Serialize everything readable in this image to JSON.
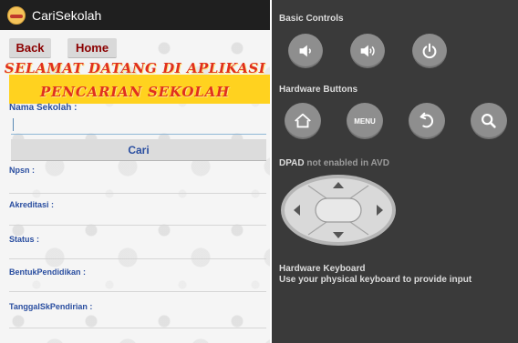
{
  "app": {
    "title": "CariSekolah",
    "buttons": {
      "back": "Back",
      "home": "Home"
    },
    "welcome": {
      "line1": "SELAMAT DATANG DI APLIKASI",
      "line2": "PENCARIAN SEKOLAH"
    },
    "search": {
      "label": "Nama Sekolah :",
      "value": "",
      "button": "Cari"
    },
    "fields": [
      {
        "label": "Npsn :"
      },
      {
        "label": "Akreditasi :"
      },
      {
        "label": "Status :"
      },
      {
        "label": "BentukPendidikan :"
      },
      {
        "label": "TanggalSkPendirian :"
      }
    ],
    "colors": {
      "actionbar": "#1f1f1f",
      "label": "#2a4ea0",
      "nav_text": "#8b0000",
      "welcome_text": "#e0301e",
      "welcome_bg": "#ffd21f"
    }
  },
  "emulator": {
    "basic_controls": {
      "title": "Basic Controls",
      "buttons": [
        "volume-down-icon",
        "volume-up-icon",
        "power-icon"
      ]
    },
    "hardware_buttons": {
      "title": "Hardware Buttons",
      "buttons": [
        "home-icon",
        "menu-button",
        "back-arrow-icon",
        "search-icon"
      ],
      "menu_label": "MENU"
    },
    "dpad": {
      "title": "DPAD",
      "note": "not enabled in AVD"
    },
    "keyboard": {
      "title": "Hardware Keyboard",
      "note": "Use your physical keyboard to provide input"
    },
    "colors": {
      "panel": "#3a3a3a",
      "button": "#8e8e8e"
    }
  }
}
